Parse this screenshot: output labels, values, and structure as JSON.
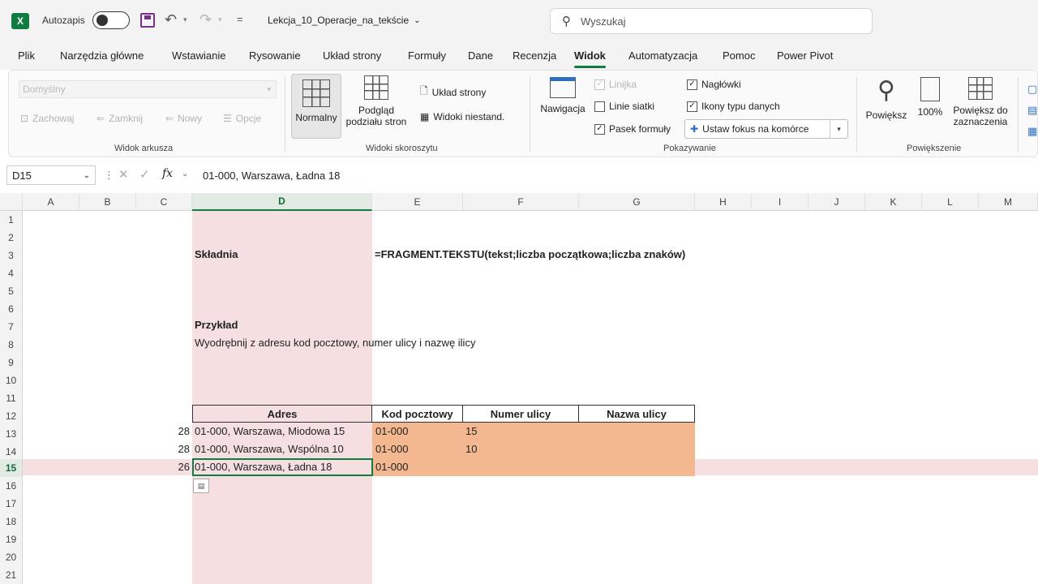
{
  "titlebar": {
    "app_logo": "X",
    "autosave_label": "Autozapis",
    "filename": "Lekcja_10_Operacje_na_tekście",
    "search_placeholder": "Wyszukaj"
  },
  "tabs": [
    {
      "label": "Plik"
    },
    {
      "label": "Narzędzia główne"
    },
    {
      "label": "Wstawianie"
    },
    {
      "label": "Rysowanie"
    },
    {
      "label": "Układ strony"
    },
    {
      "label": "Formuły"
    },
    {
      "label": "Dane"
    },
    {
      "label": "Recenzja"
    },
    {
      "label": "Widok",
      "active": true
    },
    {
      "label": "Automatyzacja"
    },
    {
      "label": "Pomoc"
    },
    {
      "label": "Power Pivot"
    }
  ],
  "ribbon": {
    "sheet_view": {
      "dropdown_value": "Domyślny",
      "keep": "Zachowaj",
      "close": "Zamknij",
      "new": "Nowy",
      "options": "Opcje",
      "group_label": "Widok arkusza"
    },
    "workbook_views": {
      "normal": "Normalny",
      "page_break_l1": "Podgląd",
      "page_break_l2": "podziału stron",
      "page_layout": "Układ strony",
      "custom_views": "Widoki niestand.",
      "group_label": "Widoki skoroszytu"
    },
    "show": {
      "navigation": "Nawigacja",
      "ruler": "Linijka",
      "gridlines": "Linie siatki",
      "formula_bar": "Pasek formuły",
      "headings": "Nagłówki",
      "data_type_icons": "Ikony typu danych",
      "focus_cell": "Ustaw fokus na komórce",
      "group_label": "Pokazywanie"
    },
    "zoom": {
      "zoom": "Powiększ",
      "hundred": "100%",
      "zoom_sel_l1": "Powiększ do",
      "zoom_sel_l2": "zaznaczenia",
      "group_label": "Powiększenie"
    }
  },
  "formula_bar": {
    "name_box": "D15",
    "fx": "fx",
    "value": "01-000, Warszawa, Ładna 18"
  },
  "sheet": {
    "columns": [
      "A",
      "B",
      "C",
      "D",
      "E",
      "F",
      "G",
      "H",
      "I",
      "J",
      "K",
      "L",
      "M"
    ],
    "rows": [
      "1",
      "2",
      "3",
      "4",
      "5",
      "6",
      "7",
      "8",
      "9",
      "10",
      "11",
      "12",
      "13",
      "14",
      "15",
      "16",
      "17",
      "18",
      "19",
      "20",
      "21"
    ],
    "cells": {
      "d3": "Składnia",
      "e3": "=FRAGMENT.TEKSTU(tekst;liczba początkowa;liczba znaków)",
      "d7": "Przykład",
      "d8": "Wyodrębnij z adresu kod pocztowy, numer ulicy i nazwę ilicy",
      "c13": "28",
      "c14": "28",
      "c15": "26",
      "d12": "Adres",
      "e12": "Kod pocztowy",
      "f12": "Numer ulicy",
      "g12": "Nazwa ulicy",
      "d13": "01-000, Warszawa, Miodowa 15",
      "d14": "01-000, Warszawa, Wspólna 10",
      "d15": "01-000, Warszawa, Ładna 18",
      "e13": "01-000",
      "e14": "01-000",
      "e15": "01-000",
      "f13": "15",
      "f14": "10"
    }
  }
}
